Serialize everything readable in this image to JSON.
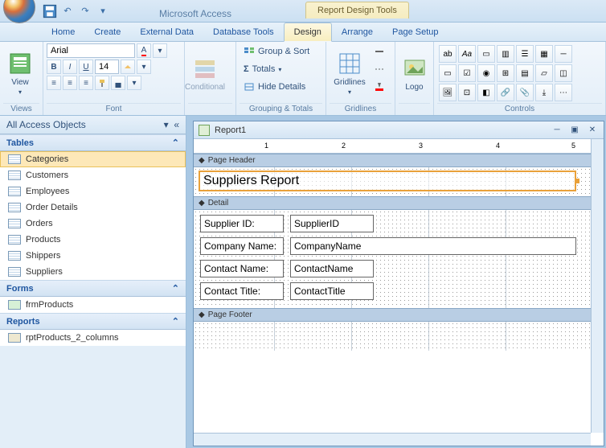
{
  "app_title": "Microsoft Access",
  "context_title": "Report Design Tools",
  "tabs": [
    "Home",
    "Create",
    "External Data",
    "Database Tools",
    "Design",
    "Arrange",
    "Page Setup"
  ],
  "active_tab": "Design",
  "font_group": {
    "font_name": "Arial",
    "font_size": "14",
    "label": "Font"
  },
  "views_label": "Views",
  "view_btn": "View",
  "conditional": "Conditional",
  "grouping": {
    "group_sort": "Group & Sort",
    "totals": "Totals",
    "hide_details": "Hide Details",
    "label": "Grouping & Totals"
  },
  "gridlines": {
    "btn": "Gridlines",
    "label": "Gridlines"
  },
  "logo": {
    "btn": "Logo"
  },
  "controls_label": "Controls",
  "nav": {
    "header": "All Access Objects",
    "sections": {
      "tables": {
        "title": "Tables",
        "items": [
          "Categories",
          "Customers",
          "Employees",
          "Order Details",
          "Orders",
          "Products",
          "Shippers",
          "Suppliers"
        ]
      },
      "forms": {
        "title": "Forms",
        "items": [
          "frmProducts"
        ]
      },
      "reports": {
        "title": "Reports",
        "items": [
          "rptProducts_2_columns"
        ]
      }
    }
  },
  "doc": {
    "title": "Report1",
    "page_header": "Page Header",
    "detail": "Detail",
    "page_footer": "Page Footer",
    "title_control": "Suppliers Report",
    "fields": [
      {
        "label": "Supplier ID:",
        "bound": "SupplierID",
        "wide": false
      },
      {
        "label": "Company Name:",
        "bound": "CompanyName",
        "wide": true
      },
      {
        "label": "Contact Name:",
        "bound": "ContactName",
        "wide": false
      },
      {
        "label": "Contact Title:",
        "bound": "ContactTitle",
        "wide": false
      }
    ],
    "ruler_marks": [
      "1",
      "2",
      "3",
      "4",
      "5"
    ]
  }
}
